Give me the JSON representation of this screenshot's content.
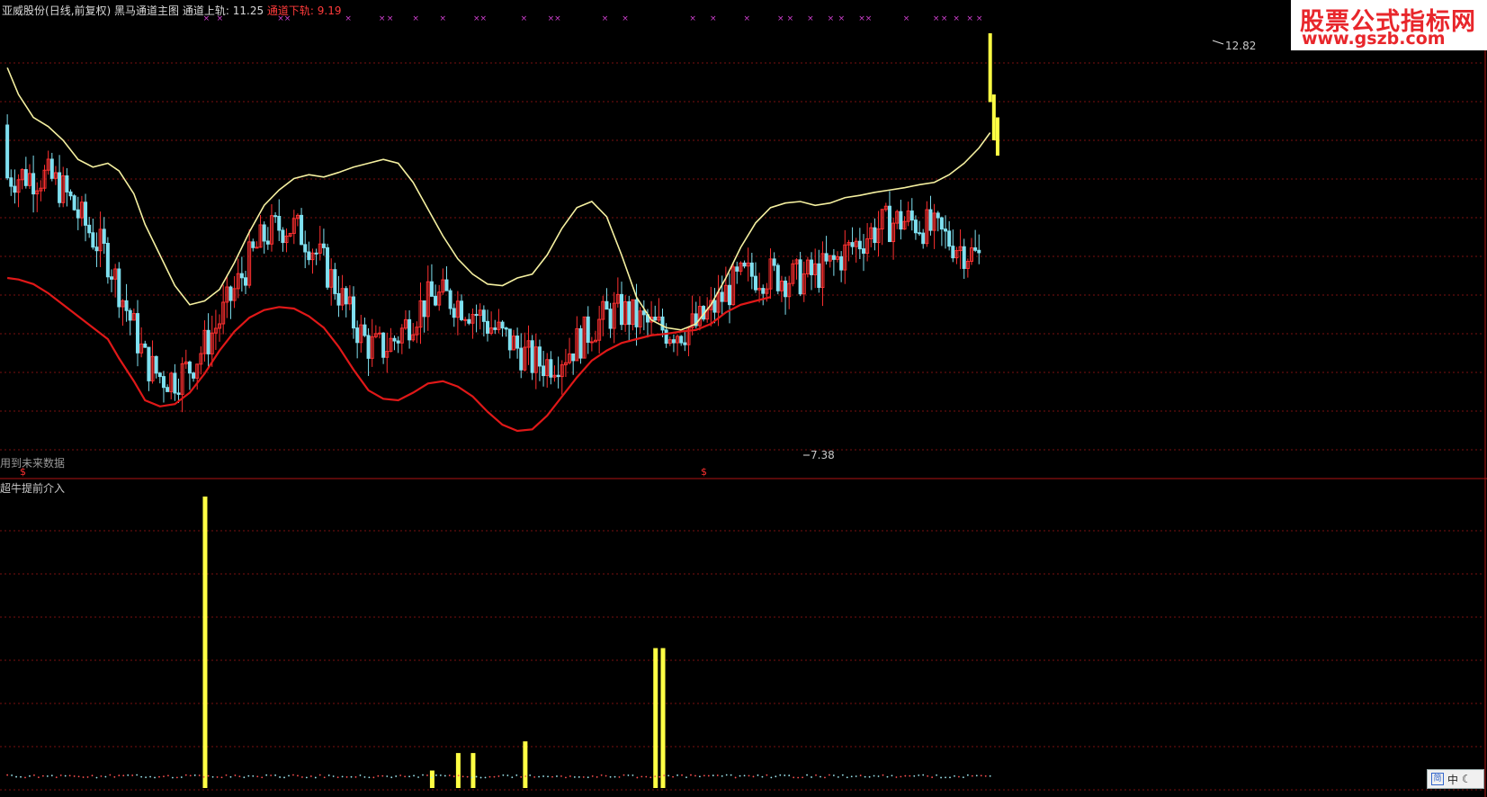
{
  "header": {
    "stock_name": "亚威股份",
    "period_info": "(日线,前复权)",
    "indicator_name": "黑马通道主图",
    "upper_label": "通道上轨: ",
    "upper_value": "11.25",
    "lower_label": "通道下轨: ",
    "lower_value": "9.19"
  },
  "labels": {
    "future_data_note": "用到未来数据",
    "sub_indicator_name": "超牛提前介入",
    "high_price": "12.82",
    "low_price": "7.38",
    "dollar_marker": "$"
  },
  "watermark": {
    "line1": "股票公式指标网",
    "line2": "www.gszb.com"
  },
  "ime": {
    "mode": "中",
    "icon": "moon-icon"
  },
  "colors": {
    "upper_band": "#f5f0a0",
    "lower_band": "#e01818",
    "bull_candle": "#ff3030",
    "bear_candle": "#7fe0f0",
    "signal_bar": "#ffff44",
    "grid": "#7a1010"
  },
  "chart_data": [
    {
      "type": "line",
      "x": [
        1,
        4,
        8,
        12,
        16,
        20,
        24,
        28,
        31,
        35,
        38,
        42,
        46,
        50,
        54,
        58,
        62,
        66,
        70,
        74,
        78,
        82,
        86,
        90,
        94,
        98,
        102,
        106,
        110,
        114,
        118,
        122,
        126,
        130,
        134,
        138,
        142,
        146,
        150,
        154,
        158,
        162,
        166,
        170,
        174,
        178,
        182,
        186,
        190,
        194,
        198,
        202,
        206,
        210,
        214,
        218,
        222,
        226,
        230,
        234,
        238,
        242,
        246,
        250,
        254,
        258,
        262,
        265
      ],
      "series": [
        {
          "values": [
            12.55,
            12.2,
            11.9,
            11.78,
            11.6,
            11.35,
            11.25,
            11.3,
            11.2,
            10.9,
            10.5,
            10.1,
            9.7,
            9.45,
            9.5,
            9.65,
            10.0,
            10.4,
            10.75,
            10.95,
            11.1,
            11.15,
            11.12,
            11.18,
            11.25,
            11.3,
            11.35,
            11.3,
            11.05,
            10.7,
            10.35,
            10.05,
            9.85,
            9.72,
            9.7,
            9.8,
            9.85,
            10.1,
            10.45,
            10.72,
            10.8,
            10.6,
            10.1,
            9.55,
            9.25,
            9.15,
            9.12,
            9.2,
            9.45,
            9.8,
            10.2,
            10.52,
            10.72,
            10.78,
            10.8,
            10.75,
            10.78,
            10.85,
            10.88,
            10.92,
            10.95,
            10.98,
            11.02,
            11.05,
            11.15,
            11.3,
            11.5,
            11.7
          ]
        },
        {
          "values": [
            9.8,
            9.78,
            9.72,
            9.6,
            9.45,
            9.3,
            9.15,
            9.0,
            8.75,
            8.45,
            8.2,
            8.12,
            8.15,
            8.3,
            8.55,
            8.85,
            9.1,
            9.28,
            9.38,
            9.42,
            9.4,
            9.3,
            9.15,
            8.9,
            8.6,
            8.33,
            8.22,
            8.2,
            8.3,
            8.42,
            8.45,
            8.38,
            8.25,
            8.05,
            7.88,
            7.8,
            7.82,
            8.0,
            8.25,
            8.5,
            8.72,
            8.85,
            8.95,
            9.0,
            9.05,
            9.07,
            9.1,
            9.12,
            9.2,
            9.35,
            9.45,
            9.5,
            9.55
          ]
        }
      ],
      "ylim": [
        7.2,
        13.2
      ],
      "xlim": [
        0,
        325
      ]
    },
    {
      "type": "bar",
      "x": [
        54,
        115,
        122,
        126,
        140,
        175,
        177
      ],
      "values": [
        100,
        6,
        12,
        12,
        16,
        48,
        48
      ],
      "ylim": [
        0,
        100
      ]
    }
  ]
}
